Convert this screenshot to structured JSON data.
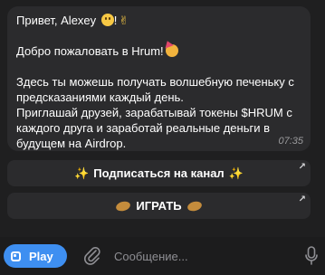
{
  "message": {
    "greeting": "Привет, Alexey ",
    "greeting_bang": "!",
    "welcome": "Добро пожаловать в Hrum!",
    "line1": "Здесь ты можешь получать волшебную печеньку с",
    "line2": "предсказаниями каждый день.",
    "line3": "Приглашай друзей, зарабатывай токены $HRUM с",
    "line4": "каждого друга и заработай реальные деньги в",
    "line5": "будущем на Airdrop.",
    "time": "07:35"
  },
  "buttons": {
    "subscribe_label": "Подписаться на канал",
    "play_game_label": "ИГРАТЬ",
    "arrow_glyph": "↗"
  },
  "input_bar": {
    "play_label": "Play",
    "placeholder": "Сообщение..."
  },
  "icons": {
    "smile": "smiling-face-icon",
    "victory": "victory-hand-icon",
    "party": "partying-face-icon",
    "sparkles": "sparkles-icon",
    "cookie": "fortune-cookie-icon",
    "paperclip": "paperclip-icon",
    "microphone": "microphone-icon"
  },
  "colors": {
    "background": "#1c1c1d",
    "bubble": "#2b2b2d",
    "accent": "#3e8ff1"
  }
}
